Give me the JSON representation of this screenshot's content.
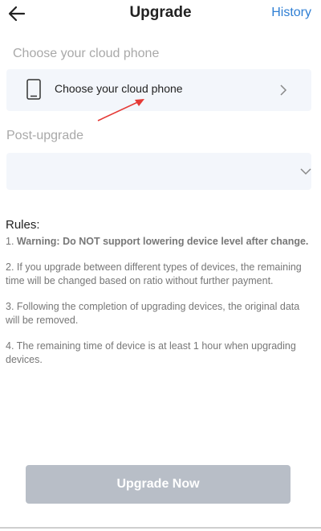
{
  "header": {
    "title": "Upgrade",
    "history_label": "History"
  },
  "phone_section": {
    "label": "Choose your cloud phone",
    "card_text": "Choose your cloud phone"
  },
  "post_upgrade": {
    "label": "Post-upgrade",
    "value": ""
  },
  "rules": {
    "title": "Rules:",
    "item1_prefix": "1. ",
    "item1_bold": "Warning: Do NOT support lowering device level after change.",
    "item2": "2. If you upgrade between different types of devices, the remaining time will be changed based on ratio without further payment.",
    "item3": "3. Following the completion of upgrading devices, the original data will be removed.",
    "item4": "4. The remaining time of device is at least 1 hour when upgrading devices."
  },
  "button": {
    "label": "Upgrade Now"
  },
  "colors": {
    "accent": "#2f7fd4",
    "card_bg": "#f3f6fb",
    "button_disabled": "#b8bec7",
    "annotation_arrow": "#e53935"
  }
}
